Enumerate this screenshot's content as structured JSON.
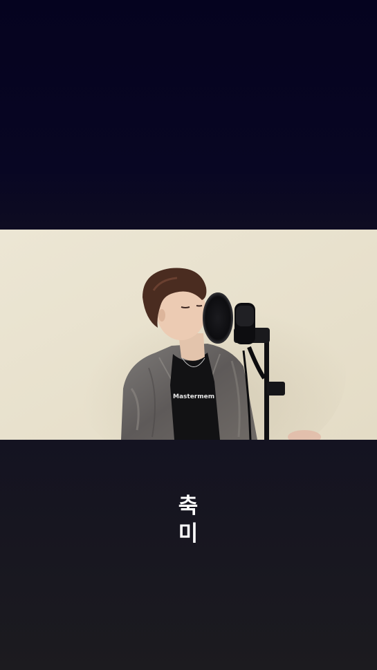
{
  "video": {
    "shirt_text": "Mastermem"
  },
  "caption": {
    "lines": [
      "축",
      "미"
    ]
  },
  "colors": {
    "top_background": "#05031f",
    "bottom_background": "#1c1b1f",
    "video_wall": "#e8e2cf",
    "caption_text": "#ffffff"
  }
}
